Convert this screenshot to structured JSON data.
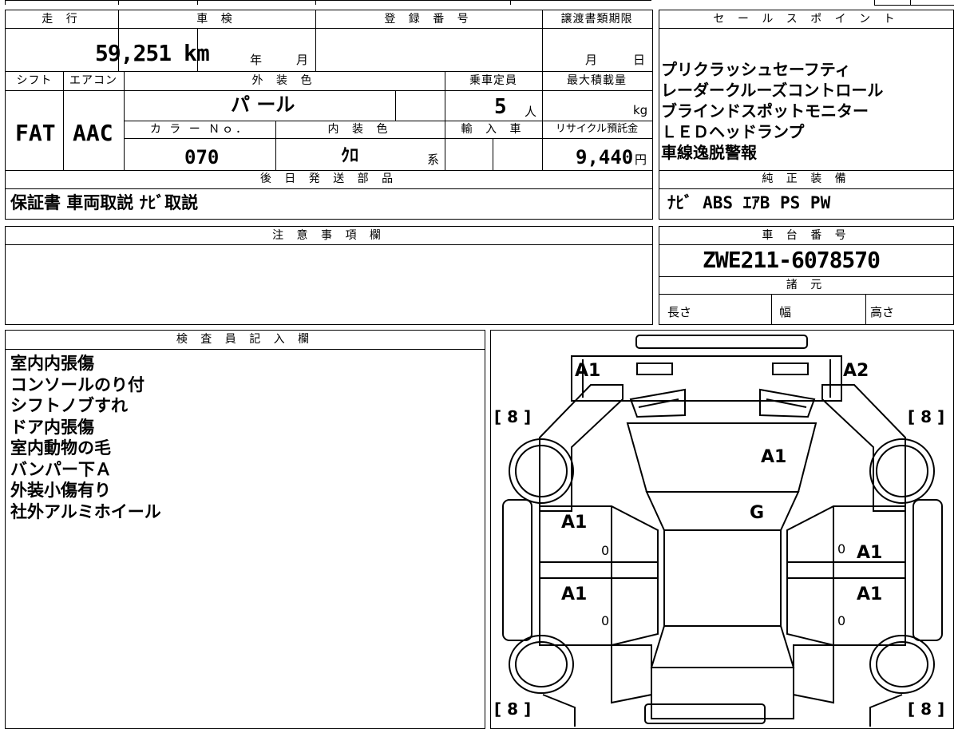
{
  "main": {
    "mileage_label": "走 行",
    "shaken_label": "車 検",
    "registration_label": "登 録 番 号",
    "transfer_deadline_label": "譲渡書類期限",
    "mileage_value": "59,251 km",
    "shaken_year": "年",
    "shaken_month": "月",
    "deadline_month": "月",
    "deadline_day": "日",
    "shift_label": "シフト",
    "aircon_label": "エアコン",
    "exterior_color_label": "外 装 色",
    "capacity_label": "乗車定員",
    "max_load_label": "最大積載量",
    "shift_value": "FAT",
    "aircon_value": "AAC",
    "exterior_color_value": "パ ール",
    "capacity_value": "5",
    "capacity_unit": "人",
    "max_load_unit": "kg",
    "color_no_label": "カ ラ ー Ｎｏ．",
    "interior_color_label": "内 装 色",
    "import_label": "輸 入 車",
    "recycle_label": "リサイクル預託金",
    "color_no_value": "070",
    "interior_color_value": "ｸﾛ",
    "interior_color_suffix": "系",
    "recycle_value": "9,440",
    "recycle_unit": "円",
    "later_parts_label": "後 日 発 送 部 品",
    "later_parts_value": "保証書 車両取説 ﾅﾋﾞ取説"
  },
  "sales": {
    "label": "セ ー ル ス ポ イ ン ト",
    "points": [
      "プリクラッシュセーフティ",
      "レーダークルーズコントロール",
      "ブラインドスポットモニター",
      "ＬＥＤヘッドランプ",
      "車線逸脱警報"
    ],
    "equipment_label": "純 正 装 備",
    "equipment_value": "ﾅﾋﾞ ABS ｴｱB PS PW"
  },
  "notes": {
    "label": "注 意 事 項 欄"
  },
  "chassis": {
    "label": "車 台 番 号",
    "value": "ZWE211-6078570",
    "spec_label": "諸 元",
    "length_label": "長さ",
    "width_label": "幅",
    "height_label": "高さ"
  },
  "inspector": {
    "label": "検 査 員 記 入 欄",
    "lines": [
      "室内内張傷",
      "コンソールのり付",
      "シフトノブすれ",
      "ドア内張傷",
      "室内動物の毛",
      "バンパー下Ａ",
      "外装小傷有り",
      "社外アルミホイール"
    ]
  },
  "diagram": {
    "front_left": "A1",
    "front_right": "A2",
    "hood": "A1",
    "windshield": "G",
    "front_left_door": "A1",
    "front_right_door": "A1",
    "rear_left_door": "A1",
    "rear_right_door": "A1",
    "zero": "0",
    "tire_fl": "[ 8 ]",
    "tire_fr": "[ 8 ]",
    "tire_rl": "[ 8 ]",
    "tire_rr": "[ 8 ]"
  }
}
